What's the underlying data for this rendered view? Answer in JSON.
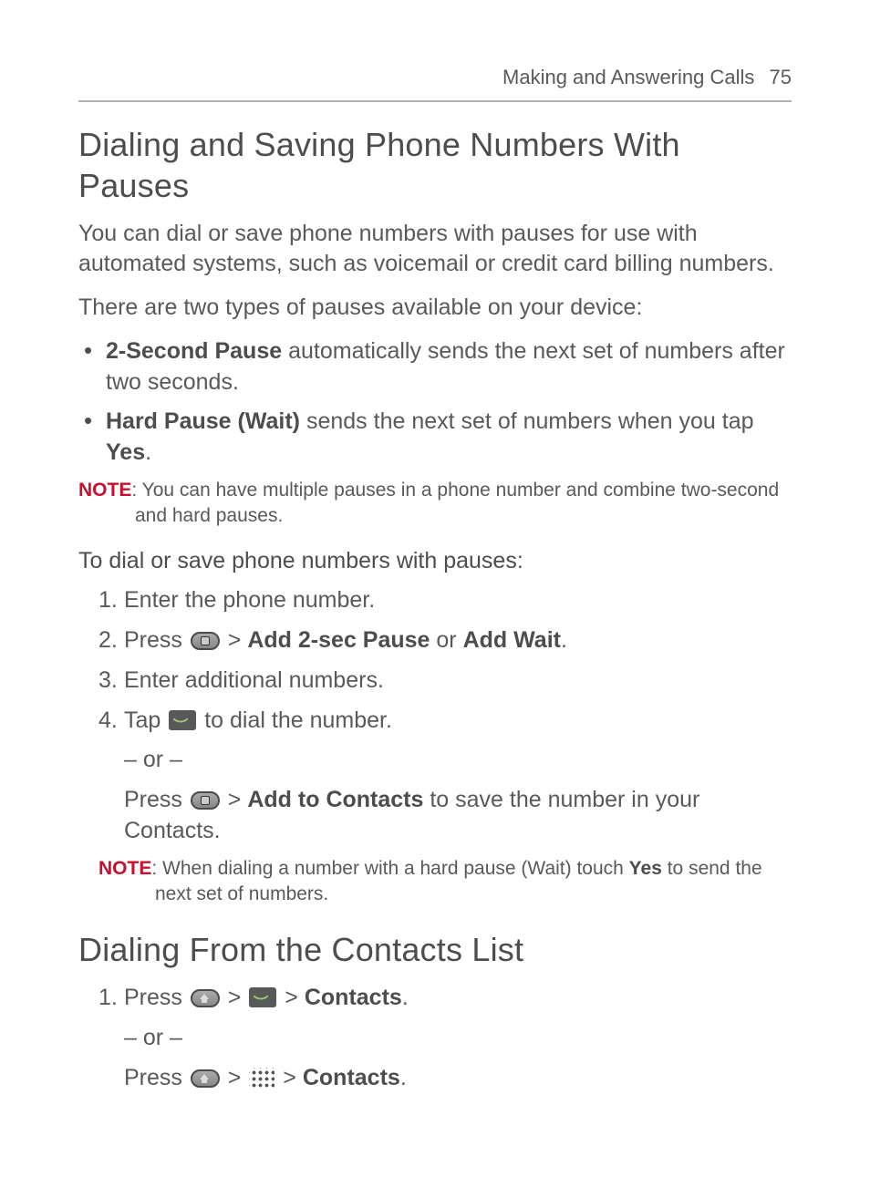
{
  "header": {
    "section": "Making and Answering Calls",
    "page": "75"
  },
  "s1": {
    "title": "Dialing and Saving Phone Numbers With Pauses",
    "intro": "You can dial or save phone numbers with pauses for use with automated systems, such as voicemail or credit card billing numbers.",
    "lead": "There are two types of pauses available on your device:",
    "b1bold": "2-Second Pause",
    "b1rest": " automatically sends the next set of numbers after two seconds.",
    "b2bold": "Hard Pause (Wait)",
    "b2rest1": " sends the next set of numbers when you tap ",
    "b2yes": "Yes",
    "b2rest2": ".",
    "note1label": "NOTE",
    "note1text": ": You can have multiple pauses in a phone number and combine two-second and hard pauses.",
    "subhead": "To dial or save phone numbers with pauses:",
    "st1": "Enter the phone number.",
    "st2a": "Press ",
    "st2gt": " > ",
    "st2b": "Add 2-sec Pause",
    "st2or": " or ",
    "st2c": "Add Wait",
    "st2end": ".",
    "st3": "Enter additional numbers.",
    "st4a": "Tap ",
    "st4b": " to dial the number.",
    "or": "– or –",
    "st4alt_a": "Press ",
    "st4alt_gt": " > ",
    "st4alt_b": "Add to Contacts",
    "st4alt_c": " to save the number in your Contacts.",
    "note2label": "NOTE",
    "note2a": ": When dialing a number with a hard pause (Wait) touch ",
    "note2yes": "Yes",
    "note2b": " to send the next set of numbers."
  },
  "s2": {
    "title": "Dialing From the Contacts List",
    "st1a": "Press ",
    "gt": " > ",
    "contacts": "Contacts",
    "end": ".",
    "or": "– or –",
    "st1b": "Press "
  }
}
